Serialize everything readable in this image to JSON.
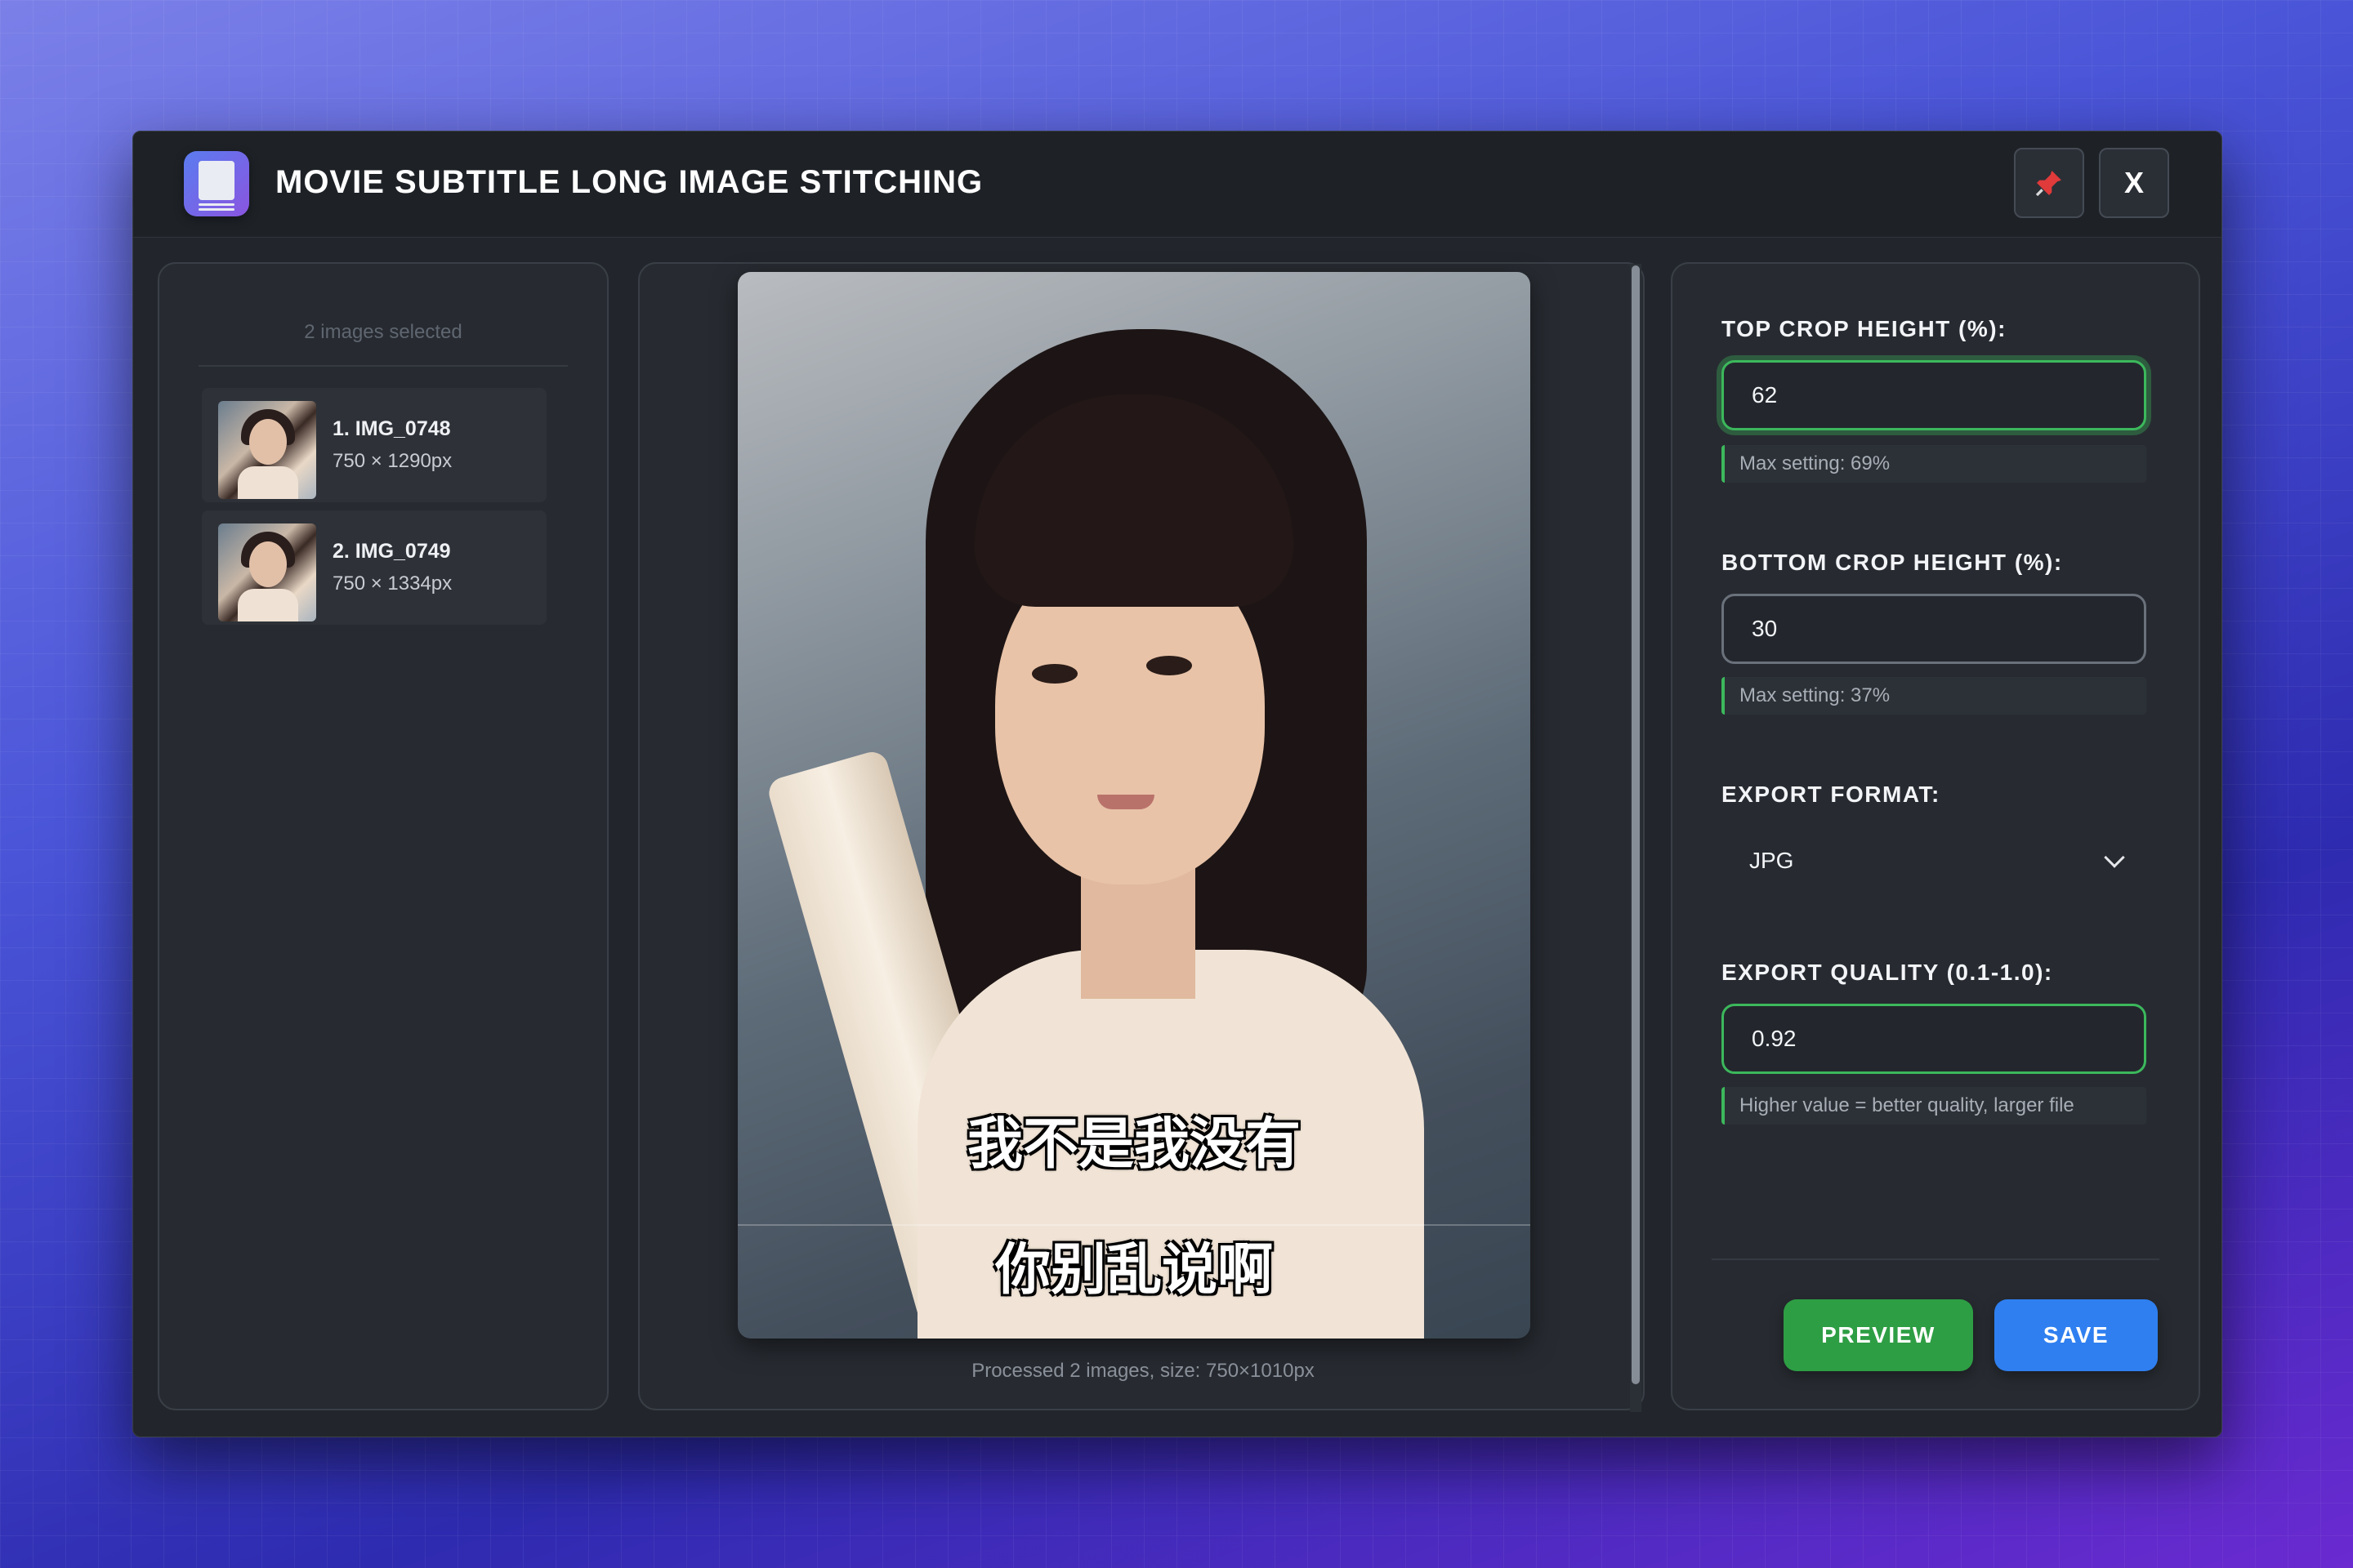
{
  "window": {
    "title": "MOVIE SUBTITLE LONG IMAGE STITCHING",
    "close_label": "X",
    "pin_icon": "pin-icon"
  },
  "image_list": {
    "count_label": "2 images selected",
    "items": [
      {
        "name": "1. IMG_0748",
        "size": "750 × 1290px"
      },
      {
        "name": "2. IMG_0749",
        "size": "750 × 1334px"
      }
    ]
  },
  "preview": {
    "subtitle_1": "我不是我没有",
    "subtitle_2": "你别乱说啊",
    "status": "Processed 2 images, size: 750×1010px"
  },
  "settings": {
    "top_crop": {
      "label": "TOP CROP HEIGHT (%):",
      "value": "62",
      "hint": "Max setting: 69%"
    },
    "bottom_crop": {
      "label": "BOTTOM CROP HEIGHT (%):",
      "value": "30",
      "hint": "Max setting: 37%"
    },
    "format": {
      "label": "EXPORT FORMAT:",
      "value": "JPG"
    },
    "quality": {
      "label": "EXPORT QUALITY (0.1-1.0):",
      "value": "0.92",
      "hint": "Higher value = better quality, larger file"
    },
    "preview_button": "PREVIEW",
    "save_button": "SAVE"
  },
  "colors": {
    "accent_green": "#2e9e44",
    "accent_blue": "#2f7ff0",
    "valid_border": "#3cb85c"
  }
}
